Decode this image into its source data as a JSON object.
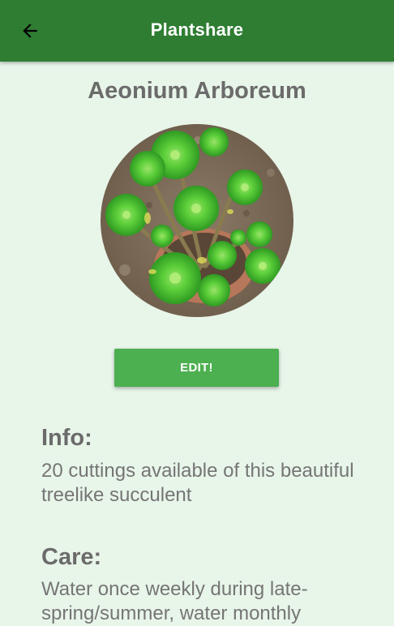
{
  "app_bar": {
    "title": "Plantshare",
    "back_icon": "arrow-back-icon",
    "background_color": "#2e7d32"
  },
  "plant": {
    "name": "Aeonium Arboreum",
    "photo": "aeonium-succulent-photo"
  },
  "edit_button": {
    "label": "EDIT!",
    "color": "#4caf50"
  },
  "info": {
    "heading": "Info:",
    "text": "20 cuttings available of this beautiful treelike succulent"
  },
  "care": {
    "heading": "Care:",
    "text": "Water once weekly during late-spring/summer, water monthly"
  },
  "colors": {
    "page_background": "#e8f5e9",
    "heading_text": "#6b6b6b",
    "body_text": "#757575"
  }
}
